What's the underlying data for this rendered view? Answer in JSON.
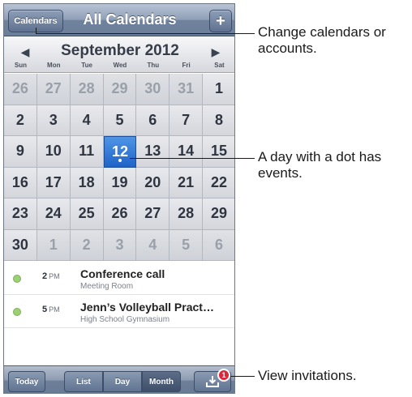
{
  "navbar": {
    "calendars_button": "Calendars",
    "title": "All Calendars",
    "add_button": "+"
  },
  "month": {
    "prev_arrow": "◀",
    "title": "September 2012",
    "next_arrow": "▶",
    "weekdays": [
      "Sun",
      "Mon",
      "Tue",
      "Wed",
      "Thu",
      "Fri",
      "Sat"
    ]
  },
  "weeks": [
    [
      {
        "n": "26",
        "other": true
      },
      {
        "n": "27",
        "other": true
      },
      {
        "n": "28",
        "other": true
      },
      {
        "n": "29",
        "other": true
      },
      {
        "n": "30",
        "other": true
      },
      {
        "n": "31",
        "other": true
      },
      {
        "n": "1"
      }
    ],
    [
      {
        "n": "2"
      },
      {
        "n": "3"
      },
      {
        "n": "4"
      },
      {
        "n": "5"
      },
      {
        "n": "6"
      },
      {
        "n": "7"
      },
      {
        "n": "8"
      }
    ],
    [
      {
        "n": "9"
      },
      {
        "n": "10"
      },
      {
        "n": "11"
      },
      {
        "n": "12",
        "today": true,
        "dot": true
      },
      {
        "n": "13"
      },
      {
        "n": "14"
      },
      {
        "n": "15"
      }
    ],
    [
      {
        "n": "16"
      },
      {
        "n": "17"
      },
      {
        "n": "18"
      },
      {
        "n": "19"
      },
      {
        "n": "20"
      },
      {
        "n": "21"
      },
      {
        "n": "22"
      }
    ],
    [
      {
        "n": "23"
      },
      {
        "n": "24"
      },
      {
        "n": "25"
      },
      {
        "n": "26"
      },
      {
        "n": "27"
      },
      {
        "n": "28"
      },
      {
        "n": "29"
      }
    ],
    [
      {
        "n": "30"
      },
      {
        "n": "1",
        "other": true
      },
      {
        "n": "2",
        "other": true
      },
      {
        "n": "3",
        "other": true
      },
      {
        "n": "4",
        "other": true
      },
      {
        "n": "5",
        "other": true
      },
      {
        "n": "6",
        "other": true
      }
    ]
  ],
  "events": [
    {
      "hour": "2",
      "ampm": "PM",
      "title": "Conference call",
      "location": "Meeting Room",
      "color": "#9bd075"
    },
    {
      "hour": "5",
      "ampm": "PM",
      "title": "Jenn’s Volleyball Pract…",
      "location": "High School Gymnasium",
      "color": "#9bd075"
    }
  ],
  "toolbar": {
    "today": "Today",
    "list": "List",
    "day": "Day",
    "month": "Month",
    "inbox_icon": "inbox-download-icon",
    "badge": "1"
  },
  "callouts": {
    "calendars": "Change calendars or accounts.",
    "dot": "A day with a dot has events.",
    "invitations": "View invitations."
  },
  "colors": {
    "today_blue": "#1f63c8",
    "event_green": "#9bd075",
    "badge_red": "#d8283a"
  }
}
